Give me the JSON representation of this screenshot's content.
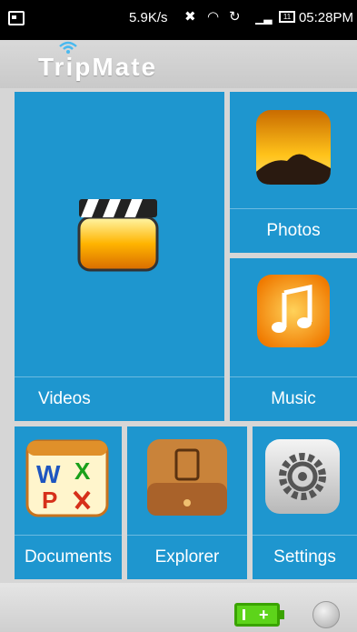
{
  "status_bar": {
    "speed": "5.9K/s",
    "battery_level": "11",
    "time": "05:28PM"
  },
  "header": {
    "app_title": "TripMate"
  },
  "tiles": {
    "videos": "Videos",
    "photos": "Photos",
    "music": "Music",
    "documents": "Documents",
    "explorer": "Explorer",
    "settings": "Settings"
  },
  "colors": {
    "tile": "#1e96cf",
    "status_bar": "#000000",
    "header": "#d0d0d0"
  },
  "icons": [
    "notification-icon",
    "mute-icon",
    "wifi-icon",
    "sync-icon",
    "signal-icon",
    "battery-icon",
    "clapperboard-icon",
    "photo-landscape-icon",
    "music-note-icon",
    "documents-icon",
    "folder-file-icon",
    "gear-icon",
    "charging-battery-icon",
    "globe-icon"
  ]
}
